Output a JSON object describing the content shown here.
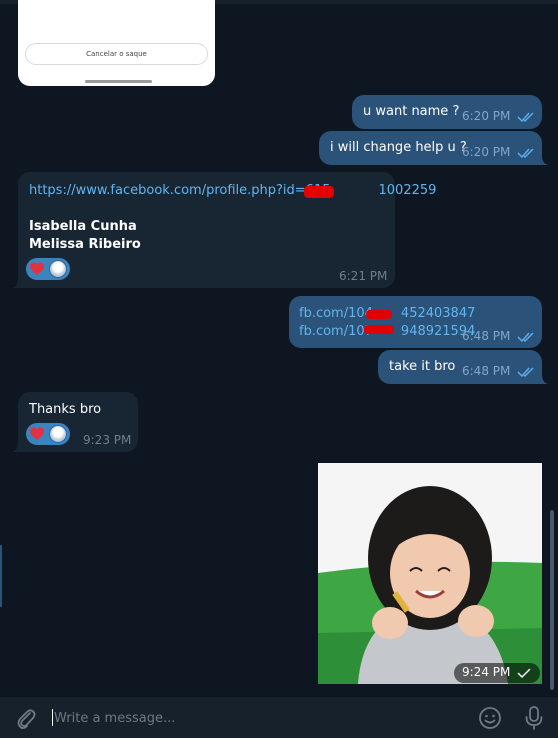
{
  "colors": {
    "background": "#0e1621",
    "outgoing_bubble": "#2b5278",
    "incoming_bubble": "#182533",
    "link": "#62b5ef",
    "read_ticks": "#5fb0f0",
    "reaction_pill": "#3a84bf",
    "heart": "#e0333f"
  },
  "top_card": {
    "cancel_label": "Cancelar o saque"
  },
  "messages": [
    {
      "direction": "outgoing",
      "text": "u want name ?",
      "time": "6:20 PM",
      "status": "read"
    },
    {
      "direction": "outgoing",
      "text": "i will change help u ?",
      "time": "6:20 PM",
      "status": "read"
    },
    {
      "direction": "incoming",
      "link": "https://www.facebook.com/profile.php?id=615",
      "link_end": "1002259",
      "lines": [
        "Isabella Cunha",
        "Melissa Ribeiro"
      ],
      "reactions": [
        "heart-icon",
        "avatar"
      ],
      "time": "6:21 PM"
    },
    {
      "direction": "outgoing",
      "links": [
        {
          "start": "fb.com/104",
          "end": "452403847"
        },
        {
          "start": "fb.com/107",
          "end": "948921594"
        }
      ],
      "time": "6:48 PM",
      "status": "read"
    },
    {
      "direction": "outgoing",
      "text": "take it bro",
      "time": "6:48 PM",
      "status": "read"
    },
    {
      "direction": "incoming",
      "text": "Thanks bro",
      "reactions": [
        "heart-icon",
        "avatar"
      ],
      "time": "9:23 PM"
    },
    {
      "direction": "outgoing",
      "type": "photo",
      "time": "9:24 PM",
      "status": "sent"
    }
  ],
  "composer": {
    "placeholder": "Write a message...",
    "value": "",
    "attach_icon": "paperclip-icon",
    "emoji_icon": "smile-icon",
    "voice_icon": "microphone-icon"
  }
}
